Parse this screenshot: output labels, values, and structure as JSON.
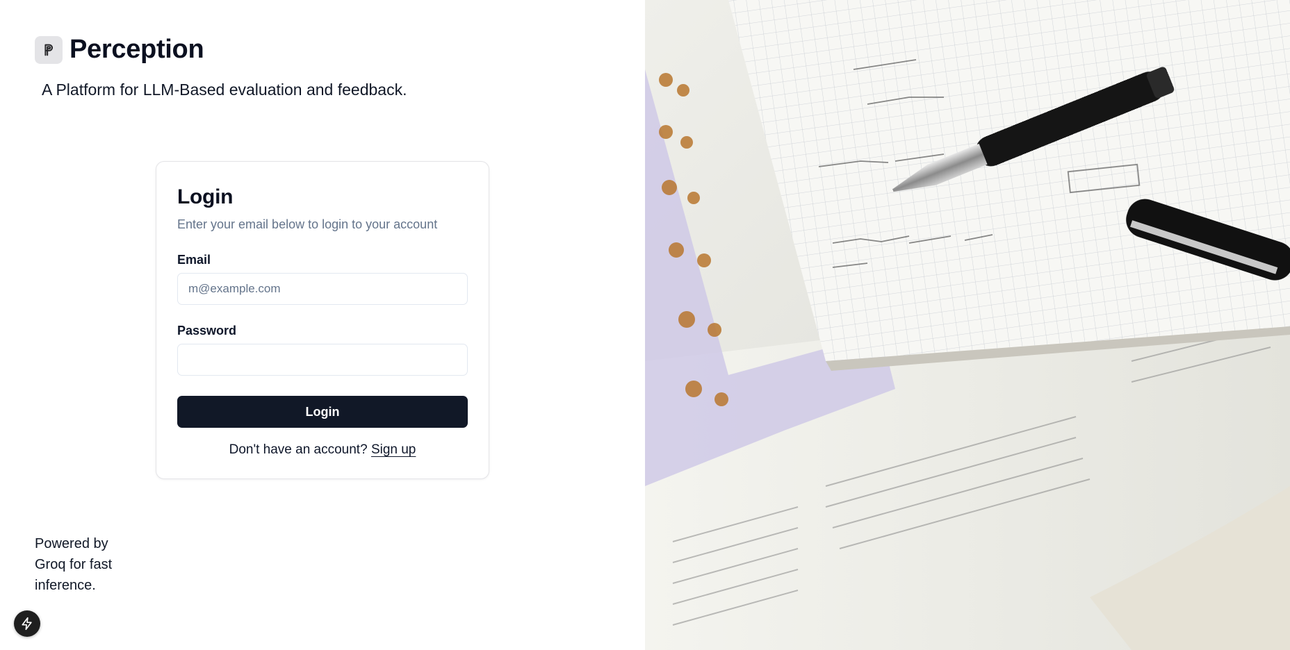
{
  "brand": {
    "logo_icon": "p-letter-icon",
    "title": "Perception",
    "tagline": "A Platform for LLM-Based evaluation and feedback."
  },
  "login": {
    "title": "Login",
    "description": "Enter your email below to login to your account",
    "email_label": "Email",
    "email_placeholder": "m@example.com",
    "email_value": "",
    "password_label": "Password",
    "password_value": "",
    "submit_label": "Login",
    "signup_prompt": "Don't have an account?",
    "signup_link": "Sign up"
  },
  "footer": {
    "powered_by": "Powered by Groq for fast inference."
  },
  "fab": {
    "icon": "lightning-icon"
  },
  "colors": {
    "primary_button": "#111827",
    "muted_text": "#64748b",
    "border": "#e4e4e7"
  }
}
